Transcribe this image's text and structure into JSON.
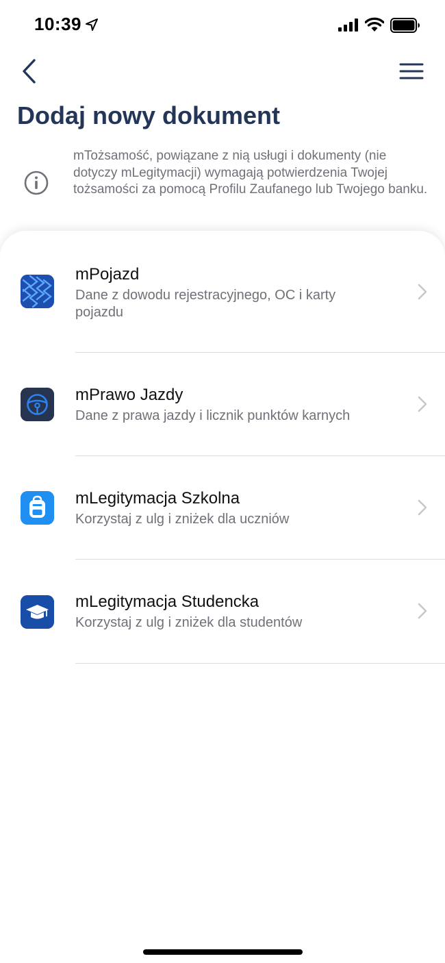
{
  "status_bar": {
    "time": "10:39",
    "location_icon": "location-arrow-icon",
    "signal_icon": "cellular-signal-icon",
    "wifi_icon": "wifi-icon",
    "battery_icon": "battery-icon"
  },
  "nav": {
    "back_icon": "chevron-left-icon",
    "menu_icon": "hamburger-menu-icon"
  },
  "page": {
    "title": "Dodaj nowy dokument"
  },
  "info": {
    "icon": "info-circle-icon",
    "text": "mTożsamość, powiązane z nią usługi i dokumenty (nie dotyczy mLegitymacji) wymagają potwierdzenia Twojej tożsamości za pomocą Profilu Zaufanego lub Twojego banku."
  },
  "documents": [
    {
      "title": "mPojazd",
      "description": "Dane z dowodu rejestracyjnego, OC i karty pojazdu",
      "icon": "tire-tread-icon"
    },
    {
      "title": "mPrawo Jazdy",
      "description": "Dane z prawa jazdy i licznik punktów karnych",
      "icon": "steering-wheel-icon"
    },
    {
      "title": "mLegitymacja Szkolna",
      "description": "Korzystaj z ulg i zniżek dla uczniów",
      "icon": "backpack-icon"
    },
    {
      "title": "mLegitymacja Studencka",
      "description": "Korzystaj z ulg i zniżek dla studentów",
      "icon": "graduation-cap-icon"
    }
  ],
  "colors": {
    "title": "#243657",
    "secondary_text": "#6f7178",
    "chevron": "#c7c7cc",
    "divider": "#dcdcdf",
    "icon_dark_blue": "#1d4fb8",
    "icon_light_blue": "#1e8cf0"
  }
}
